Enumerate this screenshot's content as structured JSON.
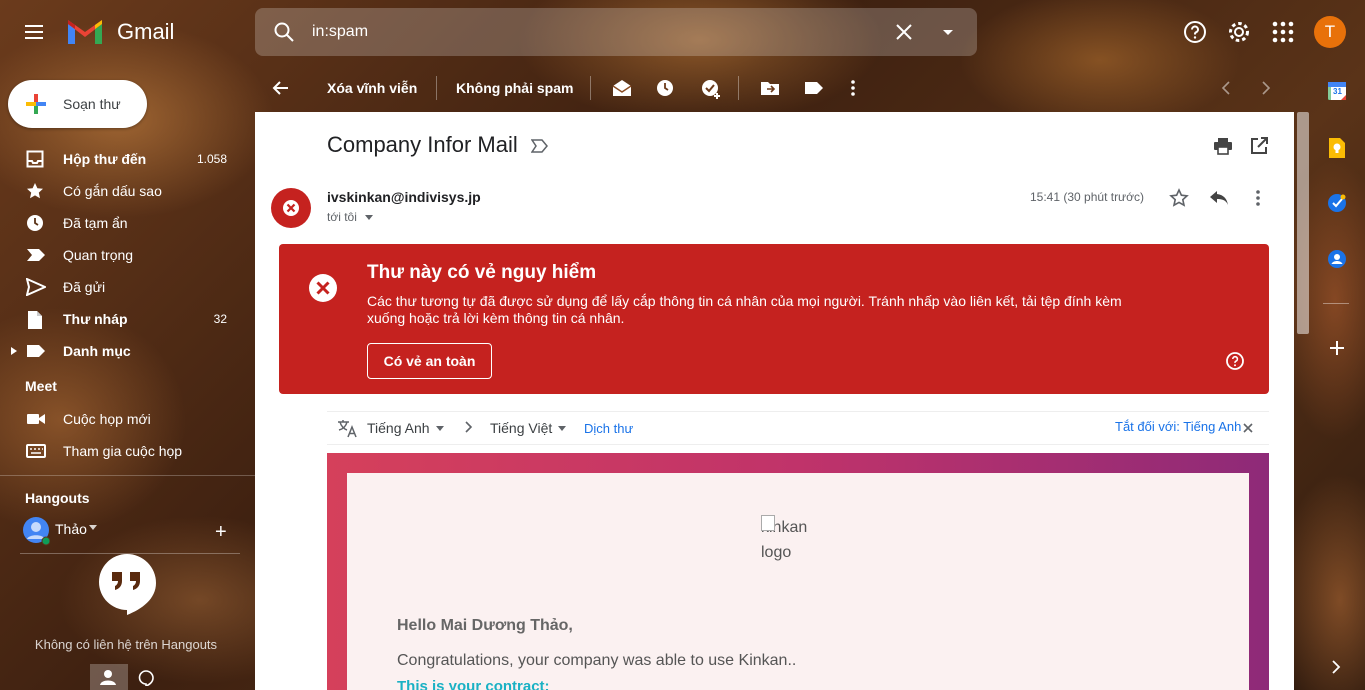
{
  "app": {
    "name": "Gmail"
  },
  "search": {
    "query": "in:spam"
  },
  "account": {
    "initial": "T",
    "color": "#e8710a"
  },
  "compose": {
    "label": "Soạn thư"
  },
  "nav": [
    {
      "label": "Hộp thư đến",
      "count": "1.058",
      "bold": true
    },
    {
      "label": "Có gắn dấu sao",
      "count": "",
      "bold": false
    },
    {
      "label": "Đã tạm ẩn",
      "count": "",
      "bold": false
    },
    {
      "label": "Quan trọng",
      "count": "",
      "bold": false
    },
    {
      "label": "Đã gửi",
      "count": "",
      "bold": false
    },
    {
      "label": "Thư nháp",
      "count": "32",
      "bold": true
    },
    {
      "label": "Danh mục",
      "count": "",
      "bold": true
    }
  ],
  "meet": {
    "title": "Meet",
    "new_meeting": "Cuộc họp mới",
    "join_meeting": "Tham gia cuộc họp"
  },
  "hangouts": {
    "title": "Hangouts",
    "user": "Thảo",
    "empty": "Không có liên hệ trên Hangouts"
  },
  "toolbar": {
    "delete_forever": "Xóa vĩnh viễn",
    "not_spam": "Không phải spam"
  },
  "email": {
    "subject": "Company Infor Mail",
    "sender": "ivskinkan@indivisys.jp",
    "recipient": "tới tôi",
    "time": "15:41 (30 phút trước)"
  },
  "warning": {
    "title": "Thư này có vẻ nguy hiểm",
    "body": "Các thư tương tự đã được sử dụng để lấy cắp thông tin cá nhân của mọi người. Tránh nhấp vào liên kết, tải tệp đính kèm xuống hoặc trả lời kèm thông tin cá nhân.",
    "button": "Có vẻ an toàn"
  },
  "translate": {
    "from": "Tiếng Anh",
    "to": "Tiếng Việt",
    "action": "Dịch thư",
    "turn_off": "Tắt đối với: Tiếng Anh"
  },
  "body": {
    "logo_alt": "kinkan logo",
    "logo_line1": "kinkan",
    "logo_line2": "logo",
    "greeting": "Hello Mai Dương Thảo,",
    "congrats": "Congratulations, your company was able to use Kinkan..",
    "contract": "This is your contract:"
  },
  "rail": {
    "calendar_day": "31"
  },
  "colors": {
    "warning": "#c5221f",
    "accent": "#1a73e8",
    "avatar": "#e8710a"
  }
}
